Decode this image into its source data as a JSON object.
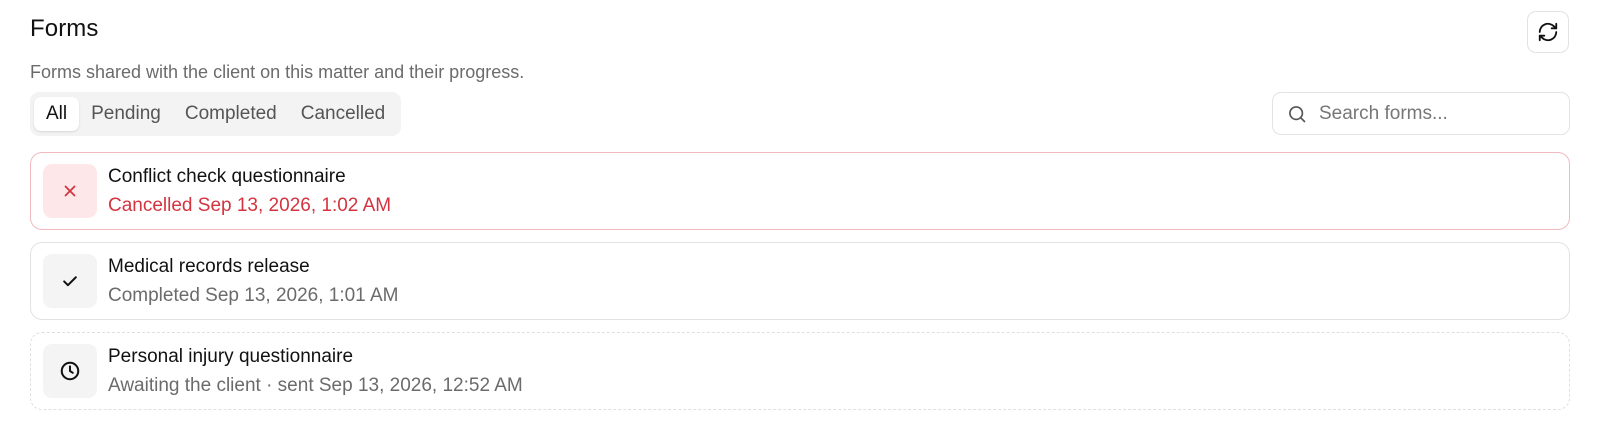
{
  "header": {
    "title": "Forms",
    "subtitle": "Forms shared with the client on this matter and their progress."
  },
  "toolbar": {
    "refresh_icon": "refresh-icon"
  },
  "tabs": [
    {
      "label": "All",
      "active": true
    },
    {
      "label": "Pending",
      "active": false
    },
    {
      "label": "Completed",
      "active": false
    },
    {
      "label": "Cancelled",
      "active": false
    }
  ],
  "search": {
    "placeholder": "Search forms...",
    "value": "",
    "icon": "search-icon"
  },
  "forms": [
    {
      "title": "Conflict check questionnaire",
      "status": "Cancelled Sep 13, 2026, 1:02 AM",
      "state": "cancelled",
      "icon": "close-icon"
    },
    {
      "title": "Medical records release",
      "status": "Completed Sep 13, 2026, 1:01 AM",
      "state": "completed",
      "icon": "check-icon"
    },
    {
      "title": "Personal injury questionnaire",
      "status": "Awaiting the client · sent Sep 13, 2026, 12:52 AM",
      "state": "pending",
      "icon": "clock-icon"
    }
  ],
  "colors": {
    "cancelled_text": "#d3343f",
    "cancelled_border": "#f1b9bd",
    "cancelled_icon_bg": "#fde7e9",
    "muted_text": "#6b6b6b"
  }
}
